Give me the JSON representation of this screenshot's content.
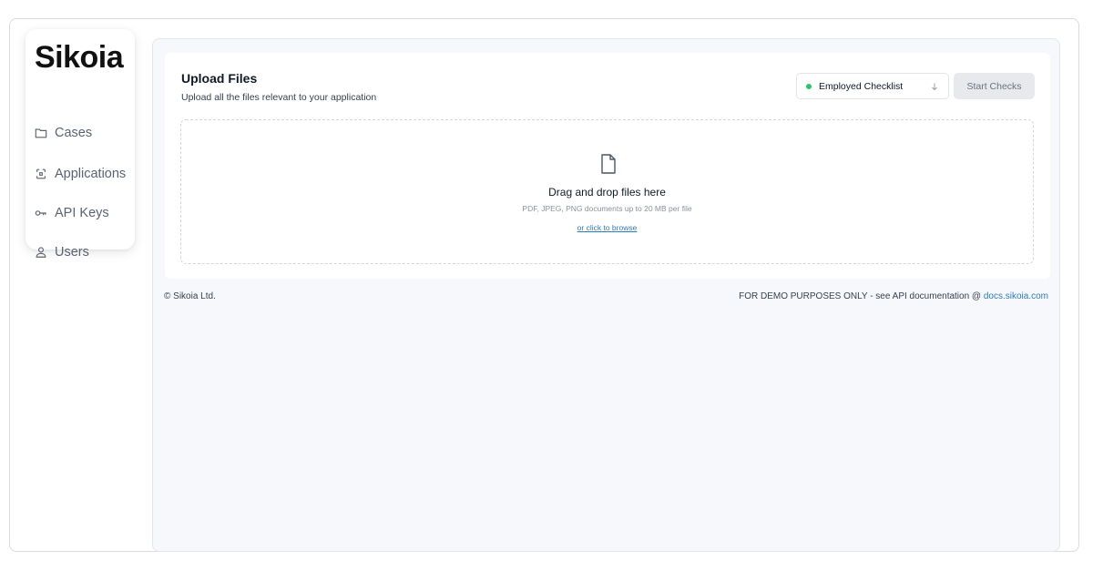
{
  "sidebar": {
    "logo": "Sikoia",
    "items": [
      {
        "label": "Cases",
        "icon": "folder-icon"
      },
      {
        "label": "Applications",
        "icon": "applications-icon"
      },
      {
        "label": "API Keys",
        "icon": "key-icon"
      },
      {
        "label": "Users",
        "icon": "user-icon"
      }
    ]
  },
  "upload": {
    "title": "Upload Files",
    "subtitle": "Upload all the files relevant to your application",
    "checklist_label": "Employed Checklist",
    "checklist_status_color": "#2fc46b",
    "start_label": "Start Checks",
    "dropzone": {
      "icon": "file-icon",
      "title": "Drag and drop files here",
      "hint": "PDF, JPEG, PNG documents up to 20 MB per file",
      "browse": "or click to browse"
    }
  },
  "footer": {
    "copyright": "© Sikoia Ltd.",
    "demo_text": "FOR DEMO PURPOSES ONLY - see API documentation @ ",
    "docs_link": "docs.sikoia.com"
  },
  "colors": {
    "accent_link": "#2f7ab8",
    "main_bg": "#f7f8fb"
  }
}
